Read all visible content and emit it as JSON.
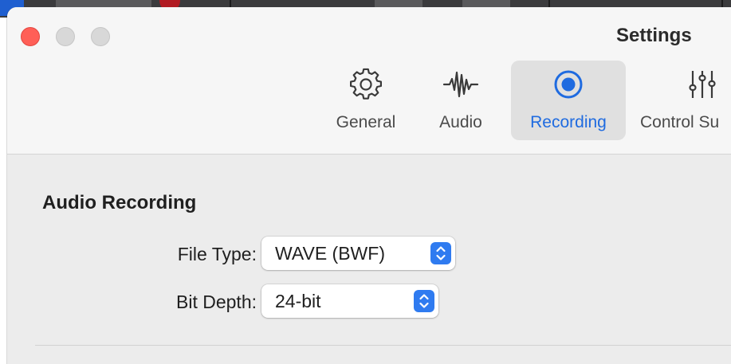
{
  "window": {
    "title": "Settings"
  },
  "toolbar": {
    "tabs": [
      {
        "label": "General",
        "icon": "gear-icon",
        "selected": false
      },
      {
        "label": "Audio",
        "icon": "waveform-icon",
        "selected": false
      },
      {
        "label": "Recording",
        "icon": "record-icon",
        "selected": true
      },
      {
        "label": "Control Su",
        "icon": "sliders-icon",
        "selected": false
      }
    ]
  },
  "audio_recording": {
    "section_title": "Audio Recording",
    "file_type": {
      "label": "File Type:",
      "value": "WAVE (BWF)"
    },
    "bit_depth": {
      "label": "Bit Depth:",
      "value": "24-bit"
    }
  },
  "colors": {
    "accent": "#1f6be0",
    "close": "#ff5f57",
    "stepper": "#2f7bf0"
  }
}
